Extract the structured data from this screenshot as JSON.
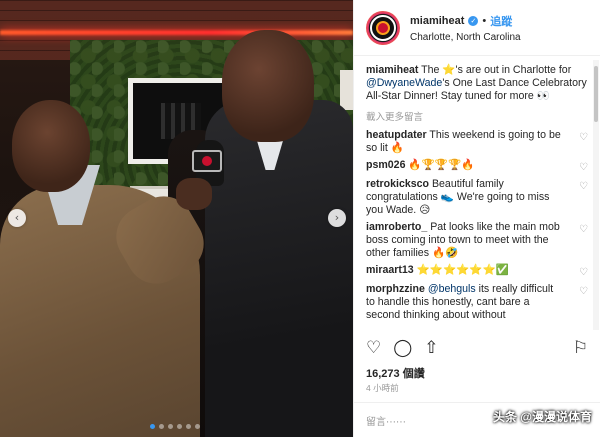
{
  "post": {
    "username": "miamiheat",
    "verified_mark": "✓",
    "dot": "•",
    "follow_label": "追蹤",
    "location": "Charlotte, North Carolina",
    "caption_user": "miamiheat",
    "caption_part1": "The ⭐'s are out in Charlotte for ",
    "caption_mention": "@DwyaneWade",
    "caption_part2": "'s One Last Dance Celebratory All-Star Dinner! Stay tuned for more 👀",
    "load_more": "載入更多留言",
    "comments": [
      {
        "user": "heatupdater",
        "text": "This weekend is going to be so lit 🔥"
      },
      {
        "user": "psm026",
        "text": "🔥🏆🏆🏆🔥"
      },
      {
        "user": "retrokicksco",
        "text": "Beautiful family congratulations 👟 We're going to miss you Wade. 😥"
      },
      {
        "user": "iamroberto_",
        "text": "Pat looks like the main mob boss coming into town to meet with the other families 🔥🤣"
      },
      {
        "user": "miraart13",
        "text": "⭐⭐⭐⭐⭐⭐✅"
      },
      {
        "user": "morphzzine",
        "mention": "@behguls",
        "text": " its really difficult to handle this honestly, cant bare a second thinking about without"
      }
    ],
    "likes": "16,273 個讚",
    "time": "4 小時前",
    "add_comment_placeholder": "留言⋯⋯"
  },
  "icons": {
    "heart": "♡",
    "comment": "◯",
    "share": "⇧",
    "save": "⚐",
    "prev": "‹",
    "next": "›"
  },
  "carousel": {
    "total": 6,
    "active": 0
  },
  "watermark": "头条 @漫漫说体育",
  "colors": {
    "accent": "#3897f0",
    "text": "#262626",
    "muted": "#999999"
  }
}
